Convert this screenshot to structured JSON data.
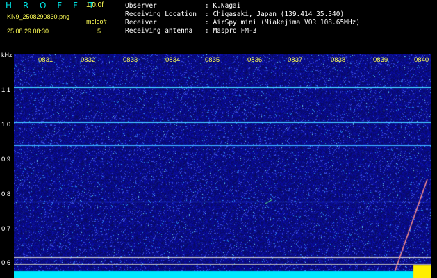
{
  "header": {
    "app_title": "H R O F F T",
    "version": "1.0.0f",
    "filename": "KN9_2508290830.png",
    "datetime": "25.08.29 08:30",
    "meleo_label": "meleo#",
    "meleo_value": "5"
  },
  "info": {
    "rows": [
      {
        "label": "Observer",
        "value": ": K.Nagai"
      },
      {
        "label": "Receiving Location",
        "value": ": Chigasaki, Japan (139.414 35.340)"
      },
      {
        "label": "Receiver",
        "value": ": AirSpy mini (Miakejima VOR 108.65MHz)"
      },
      {
        "label": "Receiving antenna",
        "value": ": Maspro FM-3"
      }
    ]
  },
  "waterfall": {
    "y_unit": "kHz",
    "y_ticks": [
      "1.1",
      "1.0",
      "0.9",
      "0.8",
      "0.7",
      "0.6"
    ],
    "y_range": [
      0.57,
      1.17
    ],
    "x_ticks": [
      "0831",
      "0832",
      "0833",
      "0834",
      "0835",
      "0836",
      "0837",
      "0838",
      "0839",
      "0840"
    ],
    "colors": {
      "background": "#000000",
      "noise_base": "#1010a0",
      "signal": "#40d0ff",
      "axis_text": "#ffff55"
    }
  }
}
